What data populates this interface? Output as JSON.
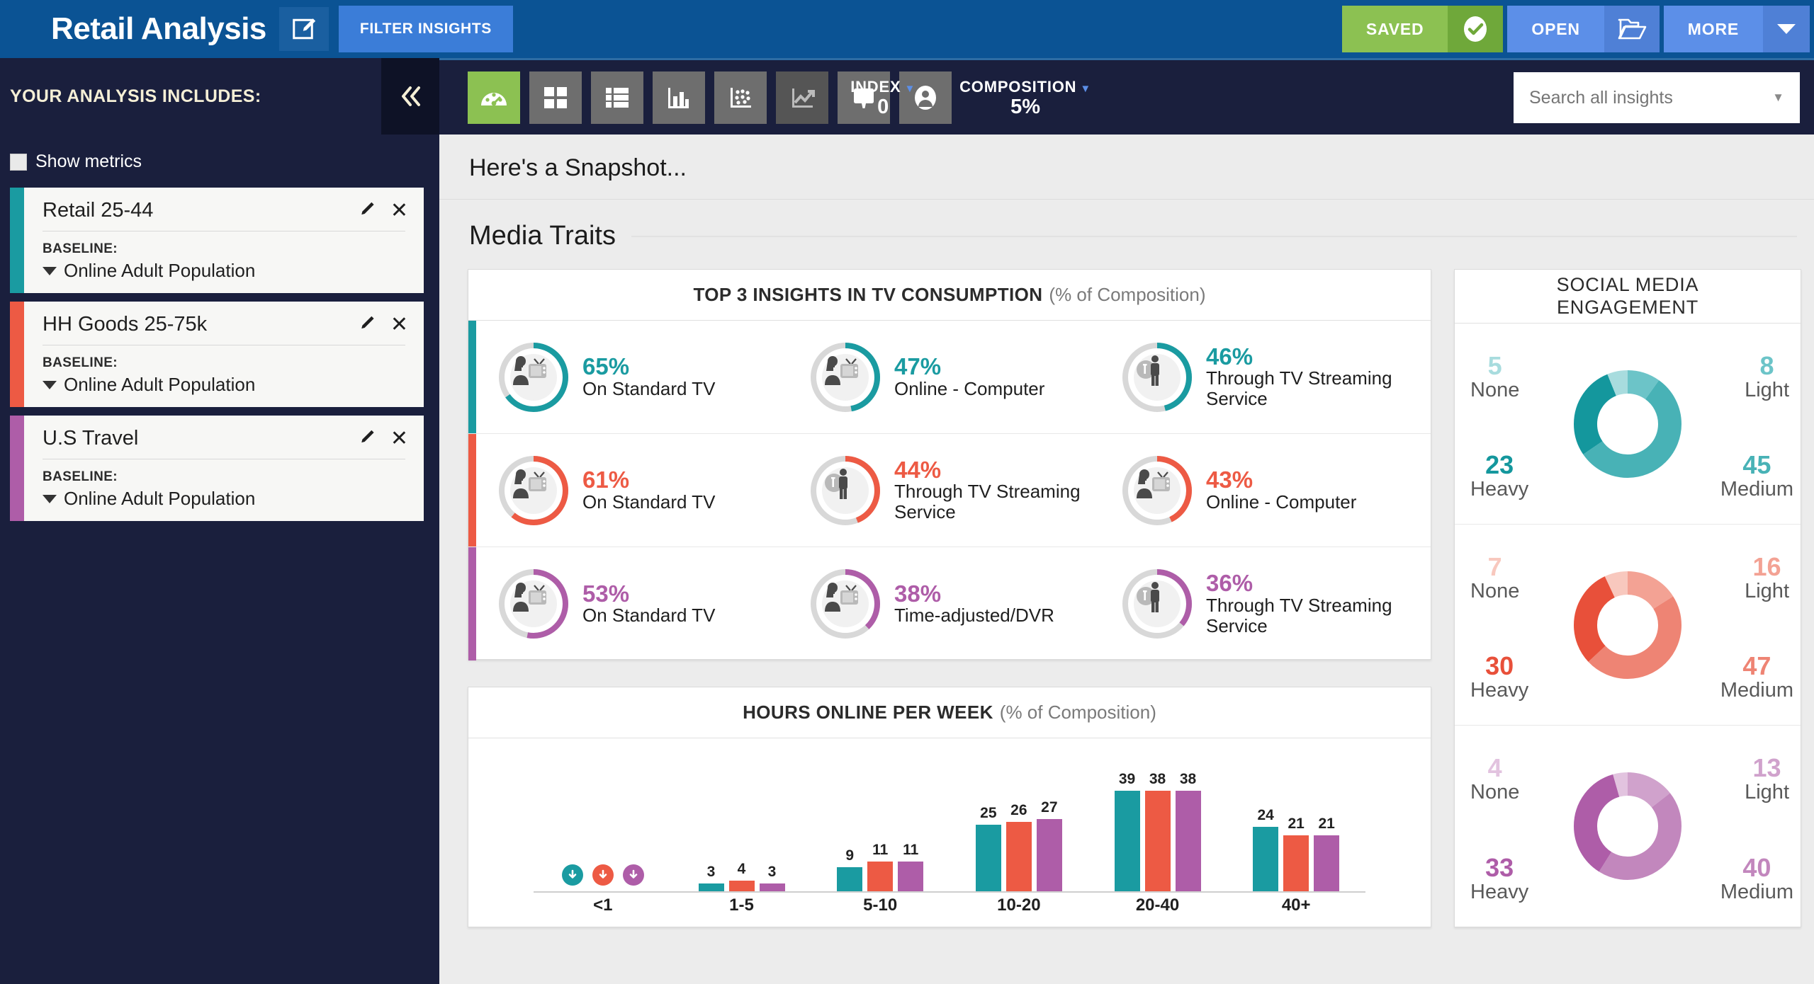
{
  "header": {
    "app_title": "Retail Analysis",
    "edit_icon": "edit-pencil-square-icon",
    "filter_button": "FILTER INSIGHTS",
    "saved_button": "SAVED",
    "saved_icon": "check-circle-icon",
    "open_button": "OPEN",
    "open_icon": "folder-open-icon",
    "more_button": "MORE",
    "more_icon": "chevron-down-icon"
  },
  "toolbar": {
    "view_icons": [
      {
        "name": "dashboard-gauge-icon",
        "active": true
      },
      {
        "name": "grid-tiles-icon",
        "active": false
      },
      {
        "name": "list-rows-icon",
        "active": false
      },
      {
        "name": "bar-chart-icon",
        "active": false
      },
      {
        "name": "scatter-plot-icon",
        "active": false
      },
      {
        "name": "trend-line-icon",
        "active": false
      },
      {
        "name": "presentation-screen-icon",
        "active": false
      },
      {
        "name": "user-profile-icon",
        "active": false
      }
    ],
    "index_label": "INDEX",
    "index_value": "0",
    "composition_label": "COMPOSITION",
    "composition_value": "5%",
    "search_placeholder": "Search all insights",
    "search_value": "",
    "search_carat_icon": "chevron-down-icon"
  },
  "sidebar": {
    "title": "YOUR ANALYSIS INCLUDES:",
    "collapse_icon": "double-chevron-left-icon",
    "show_metrics_label": "Show metrics",
    "show_metrics_checked": false,
    "baseline_label": "BASELINE:",
    "segments": [
      {
        "name": "Retail 25-44",
        "baseline": "Online Adult Population",
        "color": "#1A9BA1"
      },
      {
        "name": "HH Goods 25-75k",
        "baseline": "Online Adult Population",
        "color": "#ED5A44"
      },
      {
        "name": "U.S Travel",
        "baseline": "Online Adult Population",
        "color": "#AE5DA8"
      }
    ]
  },
  "main": {
    "snapshot_title": "Here's a Snapshot...",
    "section_title": "Media Traits"
  },
  "tv_card": {
    "title": "TOP 3 INSIGHTS IN TV CONSUMPTION",
    "subtitle": "(% of Composition)",
    "rows": [
      {
        "color": "#1A9BA1",
        "cells": [
          {
            "pct": "65%",
            "value": 65,
            "label": "On Standard TV",
            "icon": "person-watching-tv-icon"
          },
          {
            "pct": "47%",
            "value": 47,
            "label": "Online - Computer",
            "icon": "person-watching-tv-icon"
          },
          {
            "pct": "46%",
            "value": 46,
            "label": "Through TV Streaming Service",
            "icon": "person-standing-icon"
          }
        ]
      },
      {
        "color": "#ED5A44",
        "cells": [
          {
            "pct": "61%",
            "value": 61,
            "label": "On Standard TV",
            "icon": "person-watching-tv-icon"
          },
          {
            "pct": "44%",
            "value": 44,
            "label": "Through TV Streaming Service",
            "icon": "person-standing-icon"
          },
          {
            "pct": "43%",
            "value": 43,
            "label": "Online - Computer",
            "icon": "person-watching-tv-icon"
          }
        ]
      },
      {
        "color": "#AE5DA8",
        "cells": [
          {
            "pct": "53%",
            "value": 53,
            "label": "On Standard TV",
            "icon": "person-watching-tv-icon"
          },
          {
            "pct": "38%",
            "value": 38,
            "label": "Time-adjusted/DVR",
            "icon": "person-watching-tv-icon"
          },
          {
            "pct": "36%",
            "value": 36,
            "label": "Through TV Streaming Service",
            "icon": "person-standing-icon"
          }
        ]
      }
    ]
  },
  "chart_data": [
    {
      "type": "bar",
      "title": "HOURS ONLINE PER WEEK",
      "subtitle": "(% of Composition)",
      "xlabel": "",
      "ylabel": "% of Composition",
      "ylim": [
        0,
        45
      ],
      "grid": false,
      "legend": "none",
      "categories": [
        "<1",
        "1-5",
        "5-10",
        "10-20",
        "20-40",
        "40+"
      ],
      "series": [
        {
          "name": "Retail 25-44",
          "color": "#1A9BA1",
          "values": [
            null,
            3,
            9,
            25,
            39,
            24
          ]
        },
        {
          "name": "HH Goods 25-75k",
          "color": "#ED5A44",
          "values": [
            null,
            4,
            11,
            26,
            38,
            21
          ]
        },
        {
          "name": "U.S Travel",
          "color": "#AE5DA8",
          "values": [
            null,
            3,
            11,
            27,
            38,
            21
          ]
        }
      ],
      "null_marker_icon": "arrow-down-circle-icon",
      "annotations": "The '<1' category shows circular down-arrow markers instead of bars (value below reporting threshold)."
    },
    {
      "type": "pie",
      "title": "SOCIAL MEDIA ENGAGEMENT",
      "subtitle": "",
      "legend": "corners",
      "donuts": [
        {
          "series_name": "Retail 25-44",
          "labels": [
            "None",
            "Light",
            "Medium",
            "Heavy"
          ],
          "values": [
            5,
            8,
            45,
            23
          ],
          "colors": [
            "#A8DCDE",
            "#6CC4C8",
            "#48B2B6",
            "#14979D"
          ],
          "base_color": "#1A9BA1"
        },
        {
          "series_name": "HH Goods 25-75k",
          "labels": [
            "None",
            "Light",
            "Medium",
            "Heavy"
          ],
          "values": [
            7,
            16,
            47,
            30
          ],
          "colors": [
            "#F8C8BE",
            "#F3A294",
            "#EE8474",
            "#E8503A"
          ],
          "base_color": "#ED5A44"
        },
        {
          "series_name": "U.S Travel",
          "labels": [
            "None",
            "Light",
            "Medium",
            "Heavy"
          ],
          "values": [
            4,
            13,
            40,
            33
          ],
          "colors": [
            "#E2C3DF",
            "#D0A2CC",
            "#C287BD",
            "#AE5DA8"
          ],
          "base_color": "#AE5DA8"
        }
      ]
    }
  ]
}
